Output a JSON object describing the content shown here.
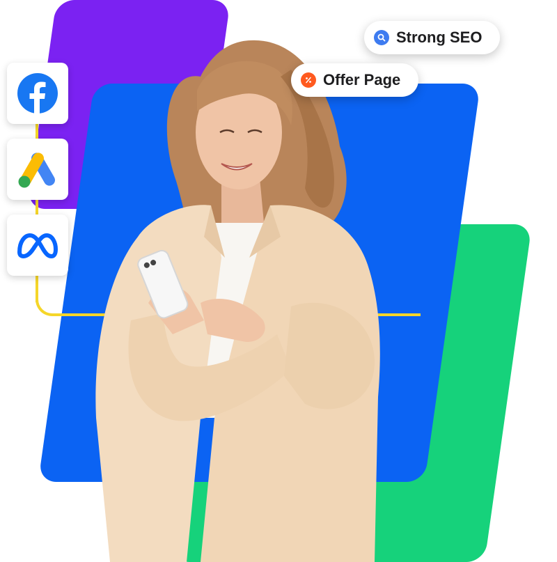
{
  "pills": {
    "seo_label": "Strong SEO",
    "offer_label": "Offer Page"
  },
  "platforms": [
    {
      "name": "facebook-icon"
    },
    {
      "name": "google-ads-icon"
    },
    {
      "name": "meta-icon"
    }
  ],
  "colors": {
    "purple": "#7b22f2",
    "blue": "#0b63f3",
    "green": "#16d27b",
    "connector": "#f5d629",
    "facebook": "#1877f2",
    "meta": "#0866ff"
  }
}
